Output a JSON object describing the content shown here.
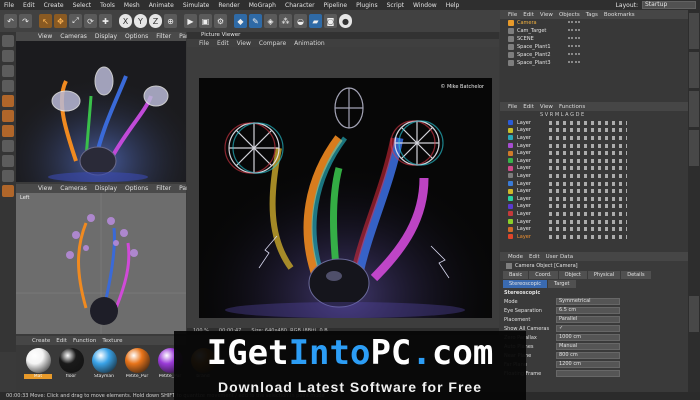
{
  "menubar": {
    "items": [
      "File",
      "Edit",
      "Create",
      "Select",
      "Tools",
      "Mesh",
      "Animate",
      "Simulate",
      "Render",
      "MoGraph",
      "Character",
      "Pipeline",
      "Plugins",
      "Script",
      "Window",
      "Help"
    ],
    "layout_label": "Layout:",
    "layout_value": "Startup"
  },
  "viewport_top": {
    "menu": [
      "View",
      "Cameras",
      "Display",
      "Options",
      "Filter",
      "Panel"
    ]
  },
  "viewport_bottom": {
    "menu": [
      "View",
      "Cameras",
      "Display",
      "Options",
      "Filter",
      "Panel"
    ],
    "label": "Left"
  },
  "picture_viewer": {
    "title": "Picture Viewer",
    "menu": [
      "File",
      "Edit",
      "View",
      "Compare",
      "Animation"
    ],
    "credit": "© Mike Batchelor",
    "zoom": "100 %",
    "status_time": "00:00:47",
    "status_info": "Size: 640x480, RGB (8Bit), 0 B"
  },
  "object_manager": {
    "menu": [
      "File",
      "Edit",
      "View",
      "Objects",
      "Tags",
      "Bookmarks"
    ],
    "objects": [
      "Camera",
      "Cam_Target",
      "SCENE",
      "Space_Plant1",
      "Space_Plant2",
      "Space_Plant3"
    ]
  },
  "layer_manager": {
    "menu": [
      "File",
      "Edit",
      "View",
      "Functions"
    ],
    "columns": "S V R M L A G D E",
    "layers": [
      {
        "name": "Layer",
        "color": "#2a5bd6"
      },
      {
        "name": "Layer",
        "color": "#c9c02a"
      },
      {
        "name": "Layer",
        "color": "#2aa8b8"
      },
      {
        "name": "Layer",
        "color": "#a74dd0"
      },
      {
        "name": "Layer",
        "color": "#d07a2a"
      },
      {
        "name": "Layer",
        "color": "#39b34a"
      },
      {
        "name": "Layer",
        "color": "#d04a8a"
      },
      {
        "name": "Layer",
        "color": "#7c7c7c"
      },
      {
        "name": "Layer",
        "color": "#3a7bd6"
      },
      {
        "name": "Layer",
        "color": "#d0b82a"
      },
      {
        "name": "Layer",
        "color": "#2ad0a0"
      },
      {
        "name": "Layer",
        "color": "#5a3ad0"
      },
      {
        "name": "Layer",
        "color": "#c43a3a"
      },
      {
        "name": "Layer",
        "color": "#8ad02a"
      },
      {
        "name": "Layer",
        "color": "#d06a2a"
      },
      {
        "name": "Layer",
        "color": "#e0452a"
      }
    ]
  },
  "attribute_manager": {
    "menu": [
      "Mode",
      "Edit",
      "User Data"
    ],
    "title": "Camera Object [Camera]",
    "tabs": [
      "Basic",
      "Coord.",
      "Object",
      "Physical",
      "Details"
    ],
    "subtabs": [
      "Stereoscopic",
      "Target"
    ],
    "section": "Stereoscopic",
    "fields": [
      {
        "label": "Mode",
        "value": "Symmetrical"
      },
      {
        "label": "Eye Separation",
        "value": "6.5 cm"
      },
      {
        "label": "Placement",
        "value": "Parallel"
      },
      {
        "label": "Show All Cameras",
        "value": "✓"
      },
      {
        "label": "Zero Parallax",
        "value": "1000 cm"
      },
      {
        "label": "Auto Planes",
        "value": "Manual"
      },
      {
        "label": "Near Plane",
        "value": "800 cm"
      },
      {
        "label": "Far Plane",
        "value": "1200 cm"
      },
      {
        "label": "Floating Frame",
        "value": ""
      }
    ]
  },
  "material_manager": {
    "menu": [
      "Create",
      "Edit",
      "Function",
      "Texture"
    ],
    "materials": [
      {
        "name": "Mat",
        "color": "#f4f4f4"
      },
      {
        "name": "floor",
        "color": "#1a1a1a"
      },
      {
        "name": "Stayman",
        "color": "#3aa3e8"
      },
      {
        "name": "Petite_Pur",
        "color": "#e8741a"
      },
      {
        "name": "Petite_Pur",
        "color": "#9a3ad8"
      },
      {
        "name": "brand",
        "color": "#e8901a"
      }
    ]
  },
  "statusbar": {
    "text": "00:00:33  Move: Click and drag to move elements. Hold down SHIFT to quantize movement / add to the selection in point mode"
  },
  "watermark": {
    "title_white1": "IGet",
    "title_blue": "Into",
    "title_white2": "PC",
    "title_dot": ".",
    "title_white3": "com",
    "subtitle": "Download Latest Software for Free"
  },
  "colors": {
    "accent_orange": "#e89a2a",
    "accent_blue": "#2c9df5"
  }
}
